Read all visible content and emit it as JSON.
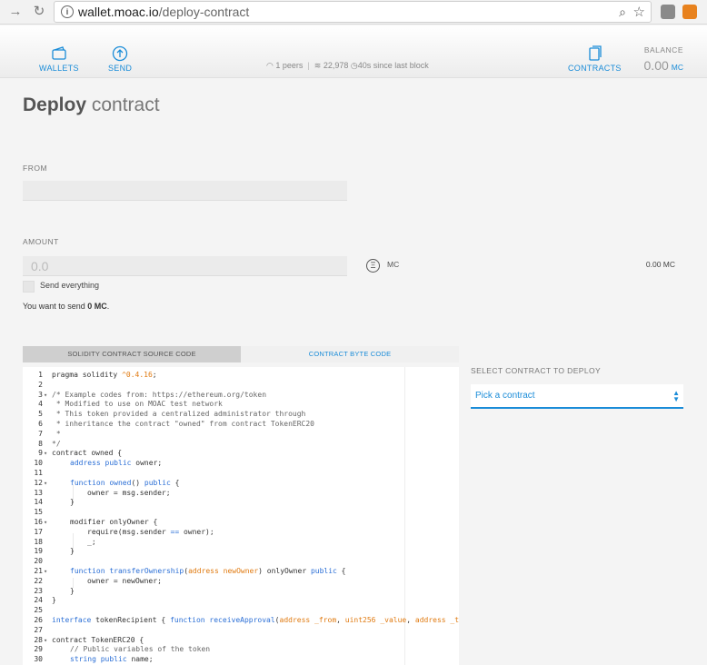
{
  "browser": {
    "url_host": "wallet.moac.io",
    "url_path": "/deploy-contract"
  },
  "header": {
    "wallets_label": "WALLETS",
    "send_label": "SEND",
    "contracts_label": "CONTRACTS",
    "peers": "1 peers",
    "blocks": "22,978",
    "since_last_block": "40s since last block",
    "balance_label": "BALANCE",
    "balance_value": "0.00",
    "balance_unit": "MC"
  },
  "page": {
    "title_bold": "Deploy",
    "title_light": "contract"
  },
  "form": {
    "from_label": "FROM",
    "amount_label": "AMOUNT",
    "amount_placeholder": "0.0",
    "currency": "MC",
    "right_amount": "0.00 MC",
    "send_everything": "Send everything",
    "you_want_prefix": "You want to send ",
    "you_want_amount": "0 MC",
    "you_want_suffix": "."
  },
  "tabs": {
    "source": "SOLIDITY CONTRACT SOURCE CODE",
    "bytecode": "CONTRACT BYTE CODE"
  },
  "select": {
    "label": "SELECT CONTRACT TO DEPLOY",
    "placeholder": "Pick a contract"
  },
  "code": {
    "l1a": "pragma solidity ",
    "l1b": "^0.4.16",
    "l1c": ";",
    "l3": "/* Example codes from: https://ethereum.org/token",
    "l4": " * Modified to use on MOAC test network",
    "l5": " * This token provided a centralized administrator through",
    "l6": " * inheritance the contract \"owned\" from contract TokenERC20",
    "l7": " *",
    "l8": "*/",
    "l9": "contract owned {",
    "l10a": "address",
    "l10b": "public",
    "l10c": " owner;",
    "l12a": "function",
    "l12b": "owned",
    "l12c": "()",
    "l12d": "public",
    "l12e": " {",
    "l13": "owner = msg.sender;",
    "l14": "}",
    "l16": "modifier onlyOwner {",
    "l17a": "require(msg.sender ",
    "l17b": "==",
    "l17c": " owner);",
    "l18": "_;",
    "l19": "}",
    "l21a": "function",
    "l21b": "transferOwnership",
    "l21c": "(",
    "l21d": "address",
    "l21e": "newOwner",
    "l21f": ") onlyOwner ",
    "l21g": "public",
    "l21h": " {",
    "l22": "owner = newOwner;",
    "l23": "}",
    "l24": "}",
    "l26a": "interface",
    "l26b": " tokenRecipient { ",
    "l26c": "function",
    "l26d": "receiveApproval",
    "l26e": "(",
    "l26f": "address",
    "l26g": "_from",
    "l26h": "uint256",
    "l26i": "_value",
    "l26j": "address",
    "l26k": "_t",
    "l28": "contract TokenERC20 {",
    "l29": "// Public variables of the token",
    "l30a": "string",
    "l30b": "public",
    "l30c": " name;"
  },
  "line_numbers": [
    "1",
    "2",
    "3",
    "4",
    "5",
    "6",
    "7",
    "8",
    "9",
    "10",
    "11",
    "12",
    "13",
    "14",
    "15",
    "16",
    "17",
    "18",
    "19",
    "20",
    "21",
    "22",
    "23",
    "24",
    "25",
    "26",
    "27",
    "28",
    "29",
    "30"
  ],
  "colors": {
    "accent": "#1a8cd8",
    "keyword": "#2b6fd6",
    "number": "#e07a10"
  }
}
